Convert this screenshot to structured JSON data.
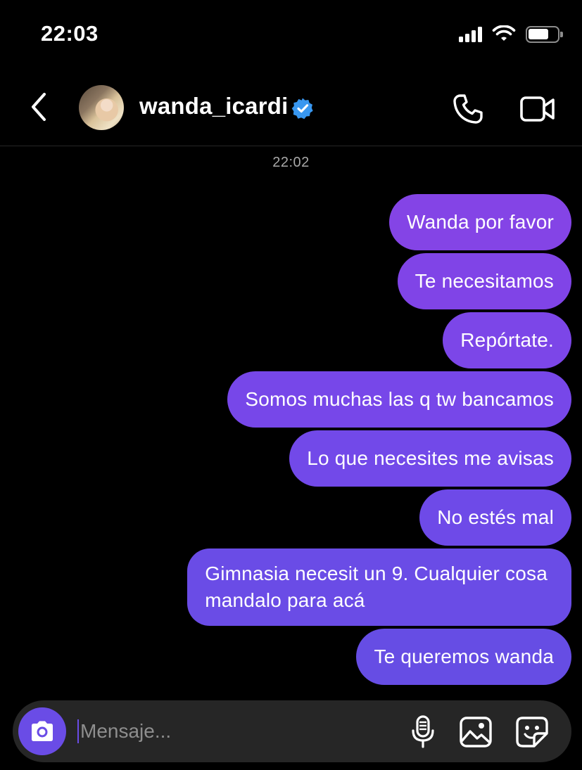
{
  "status_bar": {
    "time": "22:03",
    "signal_icon": "cellular-signal-icon",
    "wifi_icon": "wifi-icon",
    "battery_icon": "battery-icon"
  },
  "header": {
    "username": "wanda_icardi",
    "verified": true,
    "accent": "#3897f0",
    "back_icon": "chevron-left-icon",
    "call_icon": "phone-icon",
    "video_icon": "video-camera-icon"
  },
  "thread": {
    "timestamp": "22:02",
    "bubble_color": "#7a45e8",
    "messages": [
      {
        "text": "Wanda por favor"
      },
      {
        "text": "Te necesitamos"
      },
      {
        "text": "Repórtate."
      },
      {
        "text": "Somos muchas las q tw bancamos"
      },
      {
        "text": "Lo que necesites me avisas"
      },
      {
        "text": "No estés mal"
      },
      {
        "text": "Gimnasia necesit un 9. Cualquier cosa\nmandalo para acá"
      },
      {
        "text": "Te queremos wanda"
      }
    ]
  },
  "composer": {
    "placeholder": "Mensaje...",
    "value": "",
    "camera_icon": "camera-icon",
    "mic_icon": "microphone-icon",
    "gallery_icon": "image-icon",
    "sticker_icon": "sticker-icon",
    "accent": "#6a4ce6"
  }
}
